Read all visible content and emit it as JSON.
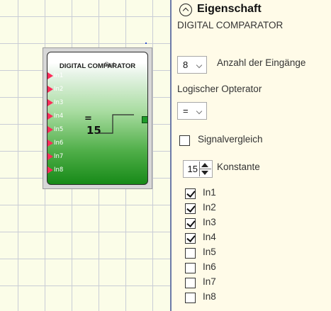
{
  "block": {
    "title": "DIGITAL COMPARATOR",
    "inputs": [
      "In1",
      "In2",
      "In3",
      "In4",
      "In5",
      "In6",
      "In7",
      "In8"
    ],
    "operator": "=",
    "constant": "15",
    "output": "Out"
  },
  "panel": {
    "title": "Eigenschaft",
    "subtitle": "DIGITAL COMPARATOR",
    "inputs_count": "8",
    "inputs_count_label": "Anzahl der Eingänge",
    "operator_label": "Logischer Opterator",
    "operator_value": "=",
    "signal_label": "Signalvergleich",
    "signal_checked": false,
    "constant_value": "15",
    "constant_label": "Konstante",
    "channels": [
      {
        "label": "In1",
        "checked": true
      },
      {
        "label": "In2",
        "checked": true
      },
      {
        "label": "In3",
        "checked": true
      },
      {
        "label": "In4",
        "checked": true
      },
      {
        "label": "In5",
        "checked": false
      },
      {
        "label": "In6",
        "checked": false
      },
      {
        "label": "In7",
        "checked": false
      },
      {
        "label": "In8",
        "checked": false
      }
    ]
  },
  "colors": {
    "panel_bg": "#fffbe8",
    "canvas_bg": "#fbfde8",
    "pin_arrow": "#ff2b5a",
    "block_green": "#178a18"
  }
}
